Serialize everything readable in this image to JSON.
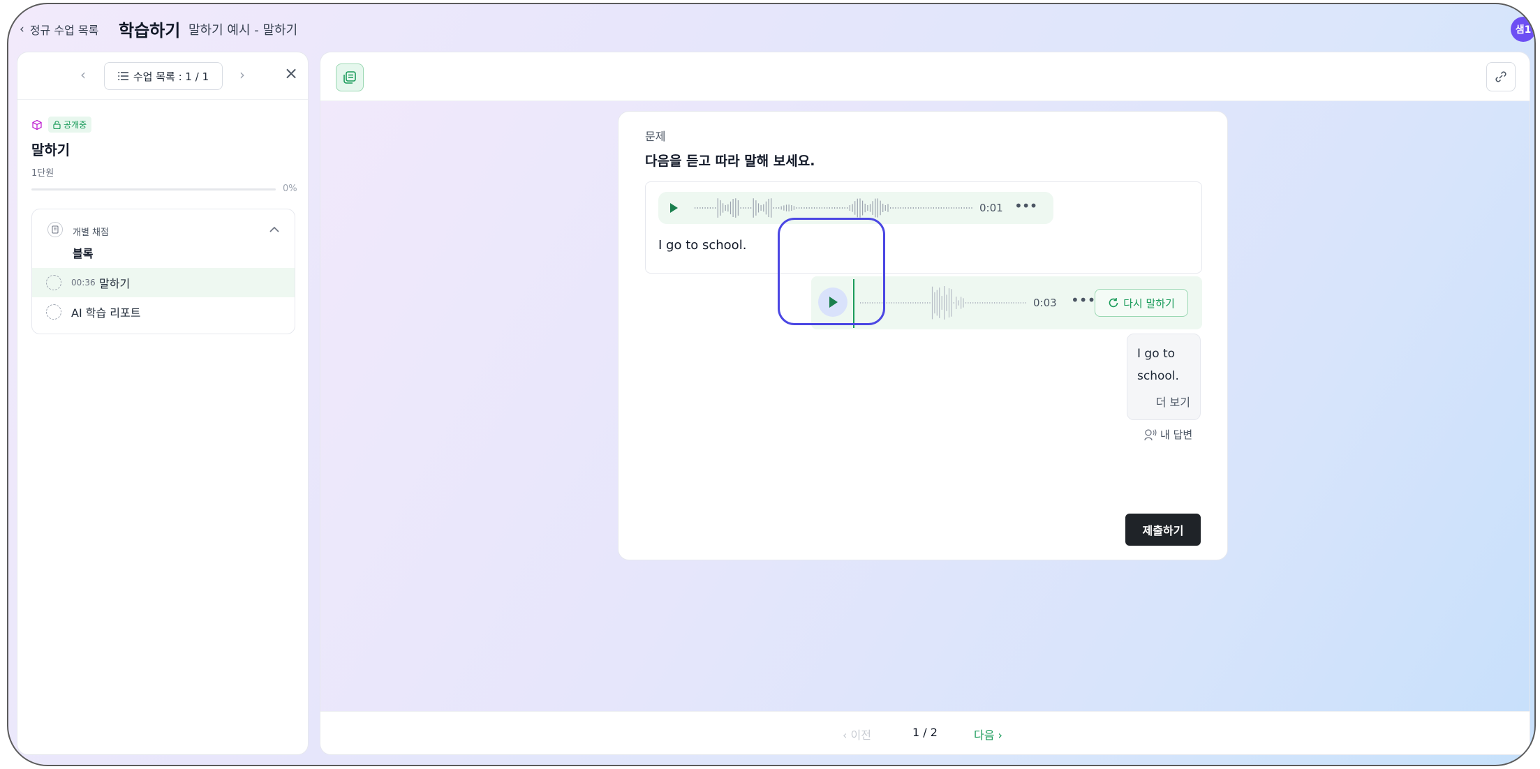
{
  "header": {
    "back_label": "정규 수업 목록",
    "title": "학습하기",
    "subtitle": "말하기 예시 - 말하기",
    "avatar_label": "샘1"
  },
  "sidebar": {
    "lesson_list_label": "수업 목록 : 1 / 1",
    "badge": "공개중",
    "title": "말하기",
    "unit": "1단원",
    "progress": "0%",
    "progress_value": 0,
    "block": {
      "grading": "개별 채점",
      "name": "블록",
      "items": [
        {
          "time": "00:36",
          "label": "말하기",
          "active": true
        },
        {
          "time": "",
          "label": "AI 학습 리포트",
          "active": false
        }
      ]
    }
  },
  "question": {
    "label": "문제",
    "instruction": "다음을 듣고 따라 말해 보세요.",
    "prompt_audio_time": "0:01",
    "prompt_text": "I go to school.",
    "response_audio_time": "0:03",
    "retry_label": "다시 말하기",
    "answer_text": "I go to school.",
    "more_label": "더 보기",
    "my_answer_label": "내 답변",
    "submit_label": "제출하기"
  },
  "pagination": {
    "prev_label": "이전",
    "page": "1 / 2",
    "next_label": "다음"
  },
  "colors": {
    "accent_green": "#1a9b5a",
    "highlight": "#4b47e3",
    "avatar": "#6d4ff3",
    "submit": "#1f2328"
  }
}
